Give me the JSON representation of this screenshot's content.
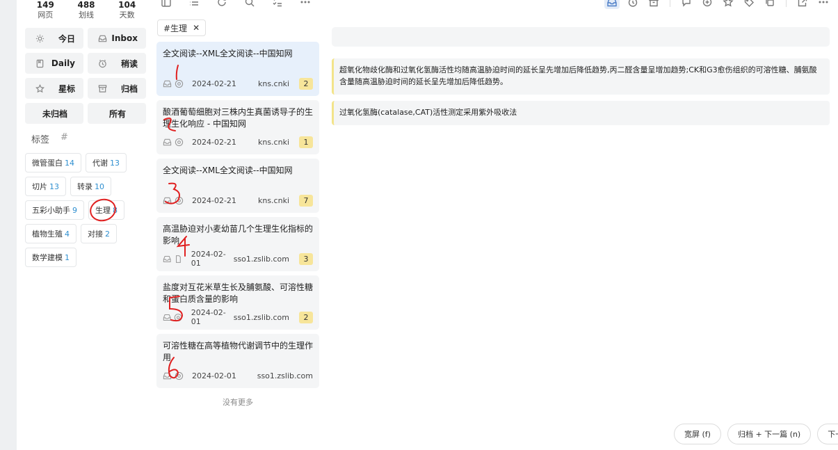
{
  "stats": [
    {
      "num": "149",
      "label": "网页"
    },
    {
      "num": "488",
      "label": "划线"
    },
    {
      "num": "104",
      "label": "天数"
    }
  ],
  "nav": {
    "today": {
      "label": "今日",
      "icon": "sun-icon"
    },
    "inbox": {
      "label": "Inbox",
      "icon": "inbox-icon"
    },
    "daily": {
      "label": "Daily",
      "icon": "book-icon"
    },
    "later": {
      "label": "稍读",
      "icon": "clock-icon"
    },
    "starred": {
      "label": "星标",
      "icon": "star-icon"
    },
    "archive": {
      "label": "归档",
      "icon": "archive-icon"
    },
    "unarchived": {
      "label": "未归档"
    },
    "all": {
      "label": "所有"
    }
  },
  "tags_section": {
    "title": "标签",
    "hash": "#"
  },
  "tags": [
    {
      "name": "微管蛋白",
      "count": "14"
    },
    {
      "name": "代谢",
      "count": "13"
    },
    {
      "name": "切片",
      "count": "13"
    },
    {
      "name": "转录",
      "count": "10"
    },
    {
      "name": "五彩小助手",
      "count": "9"
    },
    {
      "name": "生理",
      "count": "8"
    },
    {
      "name": "植物生殖",
      "count": "4"
    },
    {
      "name": "对接",
      "count": "2"
    },
    {
      "name": "数学建模",
      "count": "1"
    }
  ],
  "filter_chip": {
    "label": "#生理",
    "close": "✕"
  },
  "articles": [
    {
      "title": "全文阅读--XML全文阅读--中国知网",
      "date": "2024-02-21",
      "source": "kns.cnki",
      "count": "2",
      "selected": true
    },
    {
      "title": "酿酒葡萄细胞对三株内生真菌诱导子的生理生化响应 - 中国知网",
      "date": "2024-02-21",
      "source": "kns.cnki",
      "count": "1"
    },
    {
      "title": "全文阅读--XML全文阅读--中国知网",
      "date": "2024-02-21",
      "source": "kns.cnki",
      "count": "7"
    },
    {
      "title": "高温胁迫对小麦幼苗几个生理生化指标的影响",
      "date": "2024-02-01",
      "source": "sso1.zslib.com",
      "count": "3"
    },
    {
      "title": "盐度对互花米草生长及脯氨酸、可溶性糖和蛋白质含量的影响",
      "date": "2024-02-01",
      "source": "sso1.zslib.com",
      "count": "2"
    },
    {
      "title": "可溶性糖在高等植物代谢调节中的生理作用",
      "date": "2024-02-01",
      "source": "sso1.zslib.com",
      "count": ""
    }
  ],
  "no_more": "没有更多",
  "highlights": [
    "超氧化物歧化酶和过氧化氢酶活性均随高温胁迫时间的延长呈先增加后降低趋势,丙二醛含量呈增加趋势;CK和G3愈伤组织的可溶性糖、脯氨酸含量随高温胁迫时间的延长呈先增加后降低趋势。",
    "过氧化氢酶(catalase,CAT)活性测定采用紫外吸收法"
  ],
  "bottom_buttons": {
    "wide": "宽屏 (f)",
    "archive_next": "归档 + 下一篇 (n)",
    "next": "下一篇"
  },
  "toolbar_icons": {
    "left": [
      "sidebar-toggle-icon",
      "list-icon",
      "refresh-icon",
      "search-icon",
      "checklist-icon",
      "more-icon"
    ],
    "right": [
      "inbox-icon",
      "clock-icon",
      "archive-icon",
      "comment-icon",
      "add-icon",
      "star-icon",
      "tag-icon",
      "copy-icon",
      "external-link-icon",
      "more-icon"
    ]
  },
  "annotations": [
    "1",
    "2",
    "3",
    "4",
    "5",
    "6"
  ]
}
